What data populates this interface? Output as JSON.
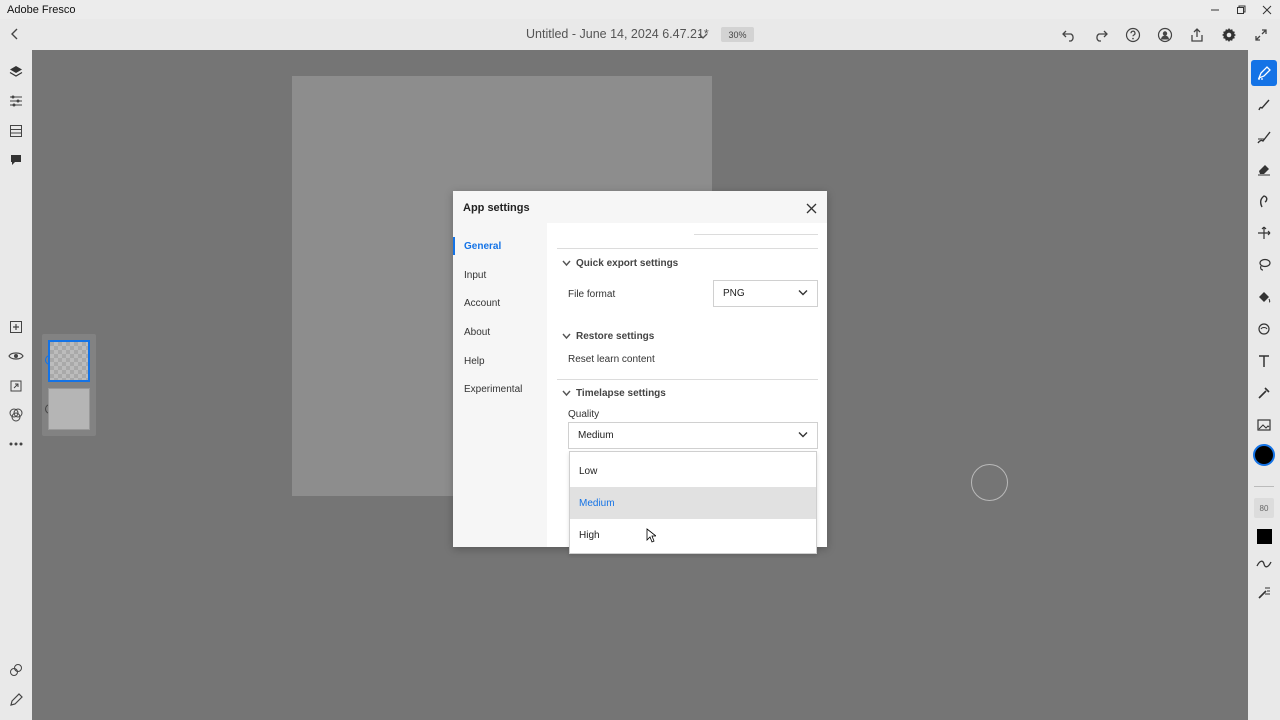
{
  "window": {
    "app_title": "Adobe Fresco",
    "controls": [
      "minimize-icon",
      "restore-icon",
      "close-icon"
    ]
  },
  "header": {
    "document_title": "Untitled - June 14, 2024 6.47.21*",
    "zoom": "30%",
    "right_icons": [
      "undo-icon",
      "redo-icon",
      "help-icon",
      "share-user-icon",
      "export-icon",
      "settings-gear-icon",
      "fullscreen-icon"
    ]
  },
  "left_rail": {
    "top_icons": [
      "layers-icon",
      "layer-properties-icon",
      "grid-icon",
      "comment-icon"
    ],
    "mid_icons": [
      "add-layer-icon",
      "visibility-icon",
      "import-icon",
      "blend-icon",
      "more-icon"
    ],
    "bottom_icons": [
      "live-brush-icon",
      "pencil-icon"
    ]
  },
  "right_rail": {
    "tools": [
      "selection-brush-icon",
      "pixel-brush-icon",
      "live-brush-icon",
      "eraser-icon",
      "smudge-icon",
      "move-icon",
      "lasso-icon",
      "fill-icon",
      "liquify-icon",
      "text-icon",
      "eyedropper-icon",
      "image-icon"
    ],
    "brush_size": "80",
    "accent_color": "#1473e6",
    "current_color": "#000000"
  },
  "dialog": {
    "title": "App settings",
    "nav": [
      "General",
      "Input",
      "Account",
      "About",
      "Help",
      "Experimental"
    ],
    "active_nav": "General",
    "quick_export": {
      "heading": "Quick export settings",
      "file_format_label": "File format",
      "file_format_value": "PNG"
    },
    "restore": {
      "heading": "Restore settings",
      "reset_label": "Reset learn content"
    },
    "timelapse": {
      "heading": "Timelapse settings",
      "quality_label": "Quality",
      "quality_value": "Medium",
      "options": [
        "Low",
        "Medium",
        "High"
      ],
      "selected_option": "Medium"
    }
  }
}
